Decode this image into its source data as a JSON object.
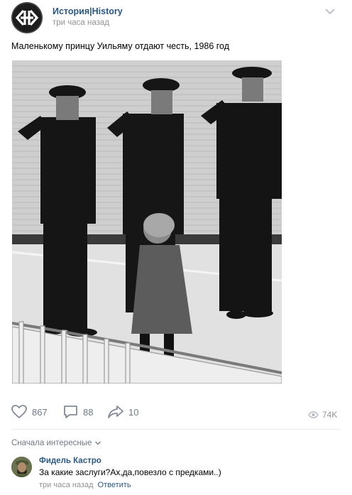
{
  "post": {
    "group_name": "История|History",
    "time": "три часа назад",
    "text": "Маленькому принцу Уильяму отдают честь, 1986 год"
  },
  "actions": {
    "likes": "867",
    "comments": "88",
    "shares": "10",
    "views": "74K"
  },
  "comments_section": {
    "sort_label": "Сначала интересные"
  },
  "comment": {
    "author": "Фидель Кастро",
    "text": "За какие заслуги?Ах,да,повезло с предками..)",
    "time": "три часа назад",
    "reply_label": "Ответить"
  },
  "colors": {
    "link": "#2a5885",
    "muted": "#939393",
    "icon": "#828a99"
  }
}
